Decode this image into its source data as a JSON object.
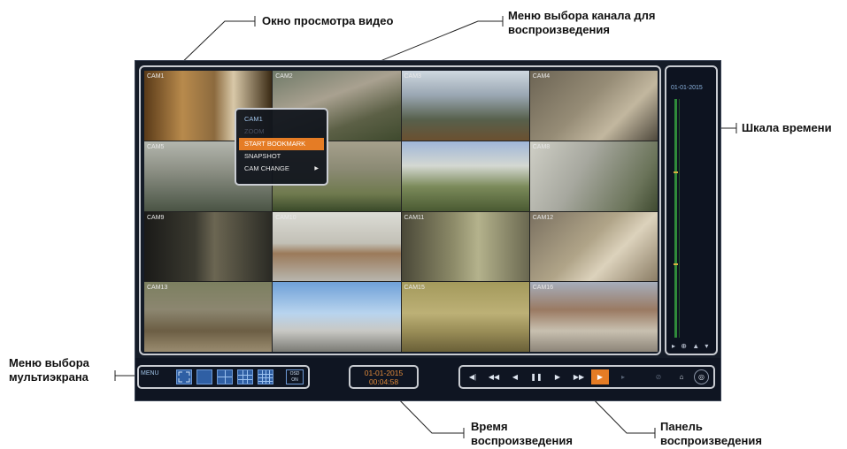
{
  "callouts": {
    "video_window": "Окно просмотра видео",
    "channel_menu_line1": "Меню выбора канала для",
    "channel_menu_line2": "воспроизведения",
    "timeline": "Шкала времени",
    "multiscreen_line1": "Меню выбора",
    "multiscreen_line2": "мультиэкрана",
    "playtime_line1": "Время",
    "playtime_line2": "воспроизведения",
    "playpanel_line1": "Панель",
    "playpanel_line2": "воспроизведения"
  },
  "cameras": [
    {
      "label": "CAM1"
    },
    {
      "label": "CAM2"
    },
    {
      "label": "CAM3"
    },
    {
      "label": "CAM4"
    },
    {
      "label": "CAM5"
    },
    {
      "label": ""
    },
    {
      "label": ""
    },
    {
      "label": "CAM8"
    },
    {
      "label": "CAM9"
    },
    {
      "label": "CAM10"
    },
    {
      "label": "CAM11"
    },
    {
      "label": "CAM12"
    },
    {
      "label": "CAM13"
    },
    {
      "label": ""
    },
    {
      "label": "CAM15"
    },
    {
      "label": "CAM16"
    }
  ],
  "context_menu": {
    "header": "CAM1",
    "zoom": "ZOOM",
    "start_bookmark": "START BOOKMARK",
    "snapshot": "SNAPSHOT",
    "cam_change": "CAM CHANGE",
    "cam_change_arrow": "▶"
  },
  "timeline": {
    "date": "01-01-2015",
    "controls": [
      "▸",
      "⊕",
      "▲",
      "▾"
    ]
  },
  "bottom_bar": {
    "menu_label": "MENU",
    "onoff_line1": "OSD",
    "onoff_line2": "ON"
  },
  "playtime": {
    "date": "01-01-2015",
    "time": "00:04:58"
  },
  "play_controls": [
    "◀|",
    "◀◀",
    "◀",
    "❚❚",
    "▶",
    "▶▶",
    "▶",
    "▸",
    "⊘",
    "⌂",
    "◎"
  ],
  "colors": {
    "accent_orange": "#e57c25",
    "screen_bg": "#151c28",
    "highlight_border": "#c9ccd2"
  }
}
